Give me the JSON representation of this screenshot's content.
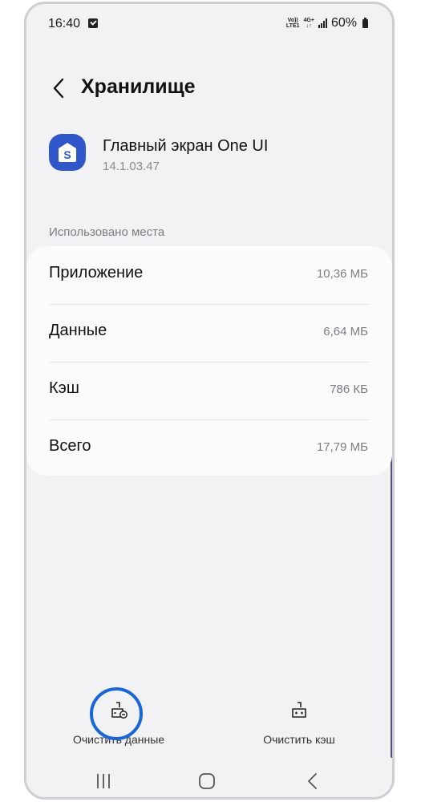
{
  "status_bar": {
    "time": "16:40",
    "volte_top": "Vo))",
    "volte_bottom": "LTE1",
    "network_top": "4G+",
    "network_bottom": "↓↑",
    "battery": "60%"
  },
  "header": {
    "title": "Хранилище"
  },
  "app": {
    "name": "Главный экран One UI",
    "version": "14.1.03.47",
    "icon_letter": "S",
    "icon_color": "#2f57c9"
  },
  "storage": {
    "section_label": "Использовано места",
    "rows": [
      {
        "label": "Приложение",
        "value": "10,36 МБ"
      },
      {
        "label": "Данные",
        "value": "6,64 МБ"
      },
      {
        "label": "Кэш",
        "value": "786 КБ"
      },
      {
        "label": "Всего",
        "value": "17,79 МБ"
      }
    ]
  },
  "actions": {
    "clear_data": "Очистить данные",
    "clear_cache": "Очистить кэш"
  },
  "colors": {
    "highlight": "#1966d6",
    "background": "#f2f2f4",
    "card": "#fbfbfc"
  }
}
